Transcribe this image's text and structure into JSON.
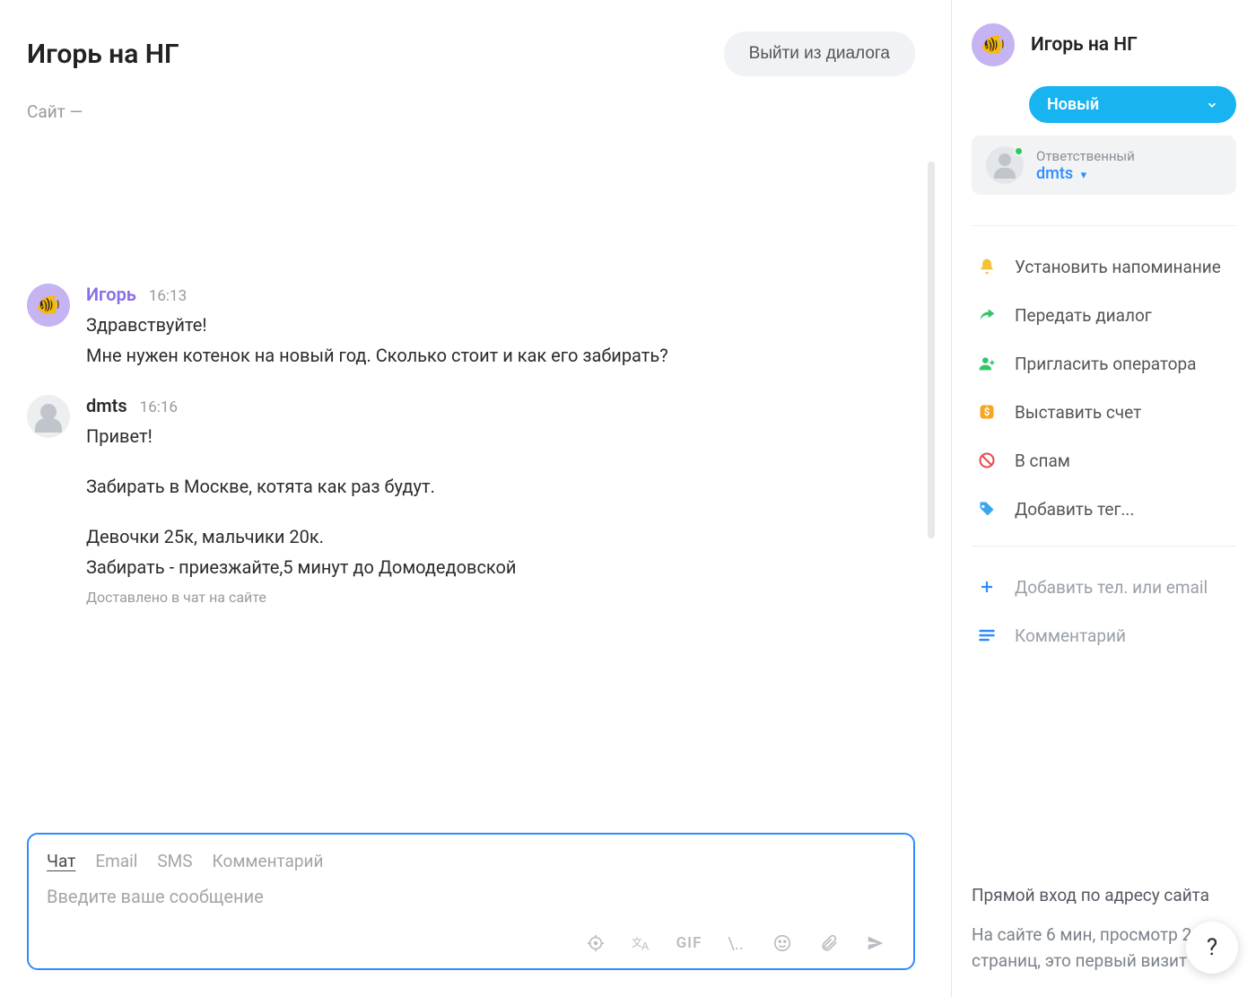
{
  "header": {
    "title": "Игорь на НГ",
    "exit_label": "Выйти из диалога",
    "site_line": "Сайт —"
  },
  "messages": [
    {
      "name": "Игорь",
      "time": "16:13",
      "name_class": "name-purple",
      "avatar": "purple",
      "lines": [
        "Здравствуйте!",
        "Мне нужен котенок на новый год. Сколько стоит и как его забирать?"
      ]
    },
    {
      "name": "dmts",
      "time": "16:16",
      "name_class": "name-dark",
      "avatar": "gray",
      "lines": [
        "Привет!",
        "",
        "Забирать в Москве, котята как раз будут.",
        "",
        "Девочки 25к, мальчики 20к.",
        "Забирать - приезжайте,5 минут до Домодедовской"
      ],
      "delivered": "Доставлено в чат на сайте"
    }
  ],
  "composer": {
    "tabs": [
      "Чат",
      "Email",
      "SMS",
      "Комментарий"
    ],
    "active_tab": 0,
    "placeholder": "Введите ваше сообщение",
    "gif_label": "GIF",
    "slash_label": "\\.."
  },
  "sidebar": {
    "title": "Игорь на НГ",
    "status": "Новый",
    "responsible_label": "Ответственный",
    "responsible_name": "dmts",
    "actions": [
      {
        "icon": "bell",
        "label": "Установить напоминание"
      },
      {
        "icon": "share",
        "label": "Передать диалог"
      },
      {
        "icon": "invite",
        "label": "Пригласить оператора"
      },
      {
        "icon": "invoice",
        "label": "Выставить счет"
      },
      {
        "icon": "spam",
        "label": "В спам"
      },
      {
        "icon": "tag",
        "label": "Добавить тег..."
      }
    ],
    "extras": [
      {
        "icon": "plus",
        "label": "Добавить тел. или email"
      },
      {
        "icon": "comment",
        "label": "Комментарий"
      }
    ],
    "direct_text": "Прямой вход по адресу сайта",
    "stats_text": "На сайте 6 мин, просмотр 2 страниц, это первый визит",
    "help": "?"
  }
}
